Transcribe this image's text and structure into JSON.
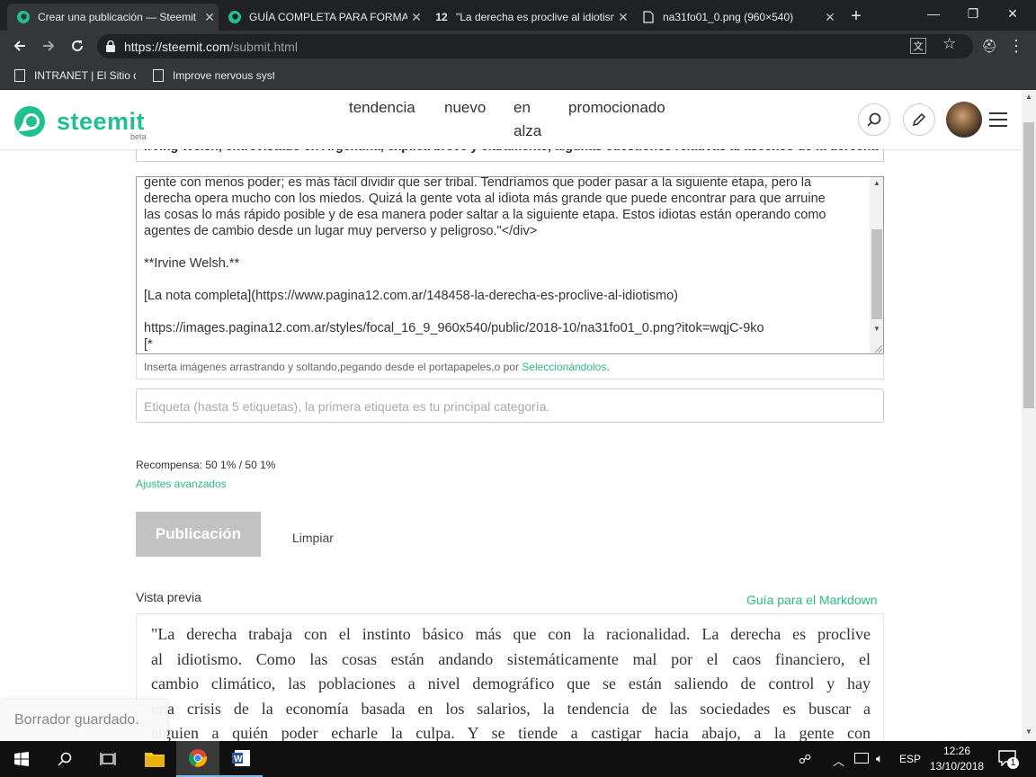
{
  "browser": {
    "tabs": [
      {
        "title": "Crear una publicación — Steemit",
        "active": true,
        "icon": "steemit-icon"
      },
      {
        "title": "GUÍA COMPLETA PARA FORMATO",
        "active": false,
        "icon": "steemit-icon"
      },
      {
        "title": "\"La derecha es proclive al idiotismo\"",
        "active": false,
        "icon": "pagina12-icon"
      },
      {
        "title": "na31fo01_0.png (960×540)",
        "active": false,
        "icon": "page-icon"
      }
    ],
    "new_tab": "+",
    "url_host": "https://steemit.com",
    "url_path": "/submit.html",
    "bookmarks": [
      "INTRANET | El Sitio de la Academia",
      "Improve nervous system"
    ]
  },
  "header": {
    "brand": "steemit",
    "brand_tag": "beta",
    "nav": [
      "tendencia",
      "nuevo",
      "en alza",
      "promocionado"
    ]
  },
  "form": {
    "top_field_text": "Irving Welsh, entrevistado en Argentina, explica breve y claramente, algunas cuestiones relativas al ascenso de la derecha",
    "editor_lines": [
      "gente con menos poder; es más fácil dividir que ser tribal. Tendríamos que poder pasar a la siguiente etapa, pero la",
      "derecha opera mucho con los miedos. Quizá la gente vota al idiota más grande que puede encontrar para que arruine",
      "las cosas lo más rápido posible y de esa manera poder saltar a la siguiente etapa. Estos idiotas están operando como",
      "agentes de cambio desde un lugar muy perverso y peligroso.\"</div>",
      "**Irvine Welsh.**",
      "[La nota completa](https://www.pagina12.com.ar/148458-la-derecha-es-proclive-al-idiotismo)",
      "https://images.pagina12.com.ar/styles/focal_16_9_960x540/public/2018-10/na31fo01_0.png?itok=wqjC-9ko",
      "[*"
    ],
    "drop_hint": "Inserta imágenes arrastrando y soltando,pegando desde el portapapeles,o por ",
    "drop_link": "Seleccionándolos",
    "tags_placeholder": "Etiqueta (hasta 5 etiquetas), la primera etiqueta es tu principal categoría.",
    "reward": "Recompensa: 50 1% / 50 1%",
    "advanced": "Ajustes avanzados",
    "publish": "Publicación",
    "clear": "Limpiar",
    "preview_label": "Vista previa",
    "markdown_guide": "Guía para el Markdown",
    "preview_lines": [
      "\"La derecha trabaja con el instinto básico más que con la racionalidad. La derecha es proclive",
      "al idiotismo. Como las cosas están andando sistemáticamente mal por el caos financiero, el",
      "cambio climático, las poblaciones a nivel demográfico que se están saliendo de control y hay",
      "una crisis de la economía basada en los salarios, la tendencia de las sociedades es buscar a",
      "alguien a quién poder echarle la culpa. Y se tiende a castigar hacia abajo, a la gente con"
    ],
    "toast": "Borrador guardado."
  },
  "taskbar": {
    "language": "ESP",
    "time": "12:26",
    "date": "13/10/2018",
    "notifications": "1"
  },
  "colors": {
    "accent": "#1fbf8f",
    "link": "#2db885",
    "chrome_dark": "#202124",
    "chrome_mid": "#35363a"
  }
}
